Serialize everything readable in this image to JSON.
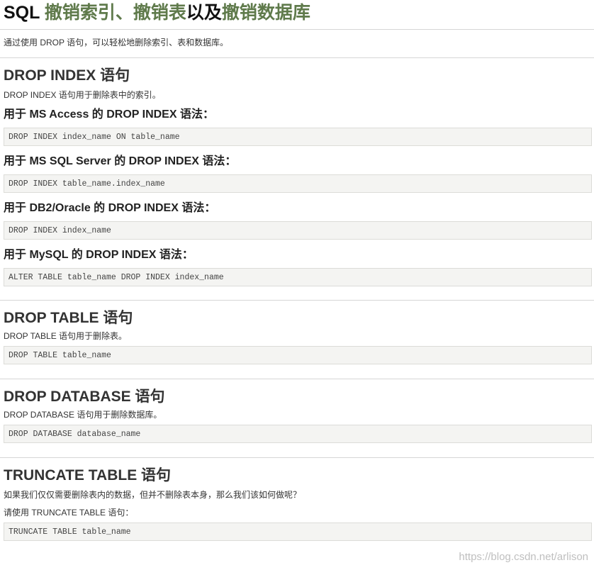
{
  "title": {
    "prefix": "SQL ",
    "part1": "撤销索引、撤销表",
    "mid": "以及",
    "part2": "撤销数据库"
  },
  "intro": "通过使用 DROP 语句，可以轻松地删除索引、表和数据库。",
  "drop_index": {
    "heading": "DROP INDEX 语句",
    "desc": "DROP INDEX 语句用于删除表中的索引。",
    "syntaxes": [
      {
        "label": "用于 MS Access 的 DROP INDEX 语法：",
        "code": "DROP INDEX index_name ON table_name"
      },
      {
        "label": "用于 MS SQL Server 的 DROP INDEX 语法：",
        "code": "DROP INDEX table_name.index_name"
      },
      {
        "label": "用于 DB2/Oracle 的 DROP INDEX 语法：",
        "code": "DROP INDEX index_name"
      },
      {
        "label": "用于 MySQL 的 DROP INDEX 语法：",
        "code": "ALTER TABLE table_name DROP INDEX index_name"
      }
    ]
  },
  "drop_table": {
    "heading": "DROP TABLE 语句",
    "desc": "DROP TABLE 语句用于删除表。",
    "code": "DROP TABLE table_name"
  },
  "drop_database": {
    "heading": "DROP DATABASE 语句",
    "desc": "DROP DATABASE 语句用于删除数据库。",
    "code": "DROP DATABASE database_name"
  },
  "truncate_table": {
    "heading": "TRUNCATE TABLE 语句",
    "desc1": "如果我们仅仅需要删除表内的数据，但并不删除表本身，那么我们该如何做呢？",
    "desc2": "请使用 TRUNCATE TABLE 语句：",
    "code": "TRUNCATE TABLE table_name"
  },
  "watermark": "https://blog.csdn.net/arlison",
  "colors": {
    "accent": "#5f7a4b",
    "code_bg": "#f4f4f2"
  }
}
